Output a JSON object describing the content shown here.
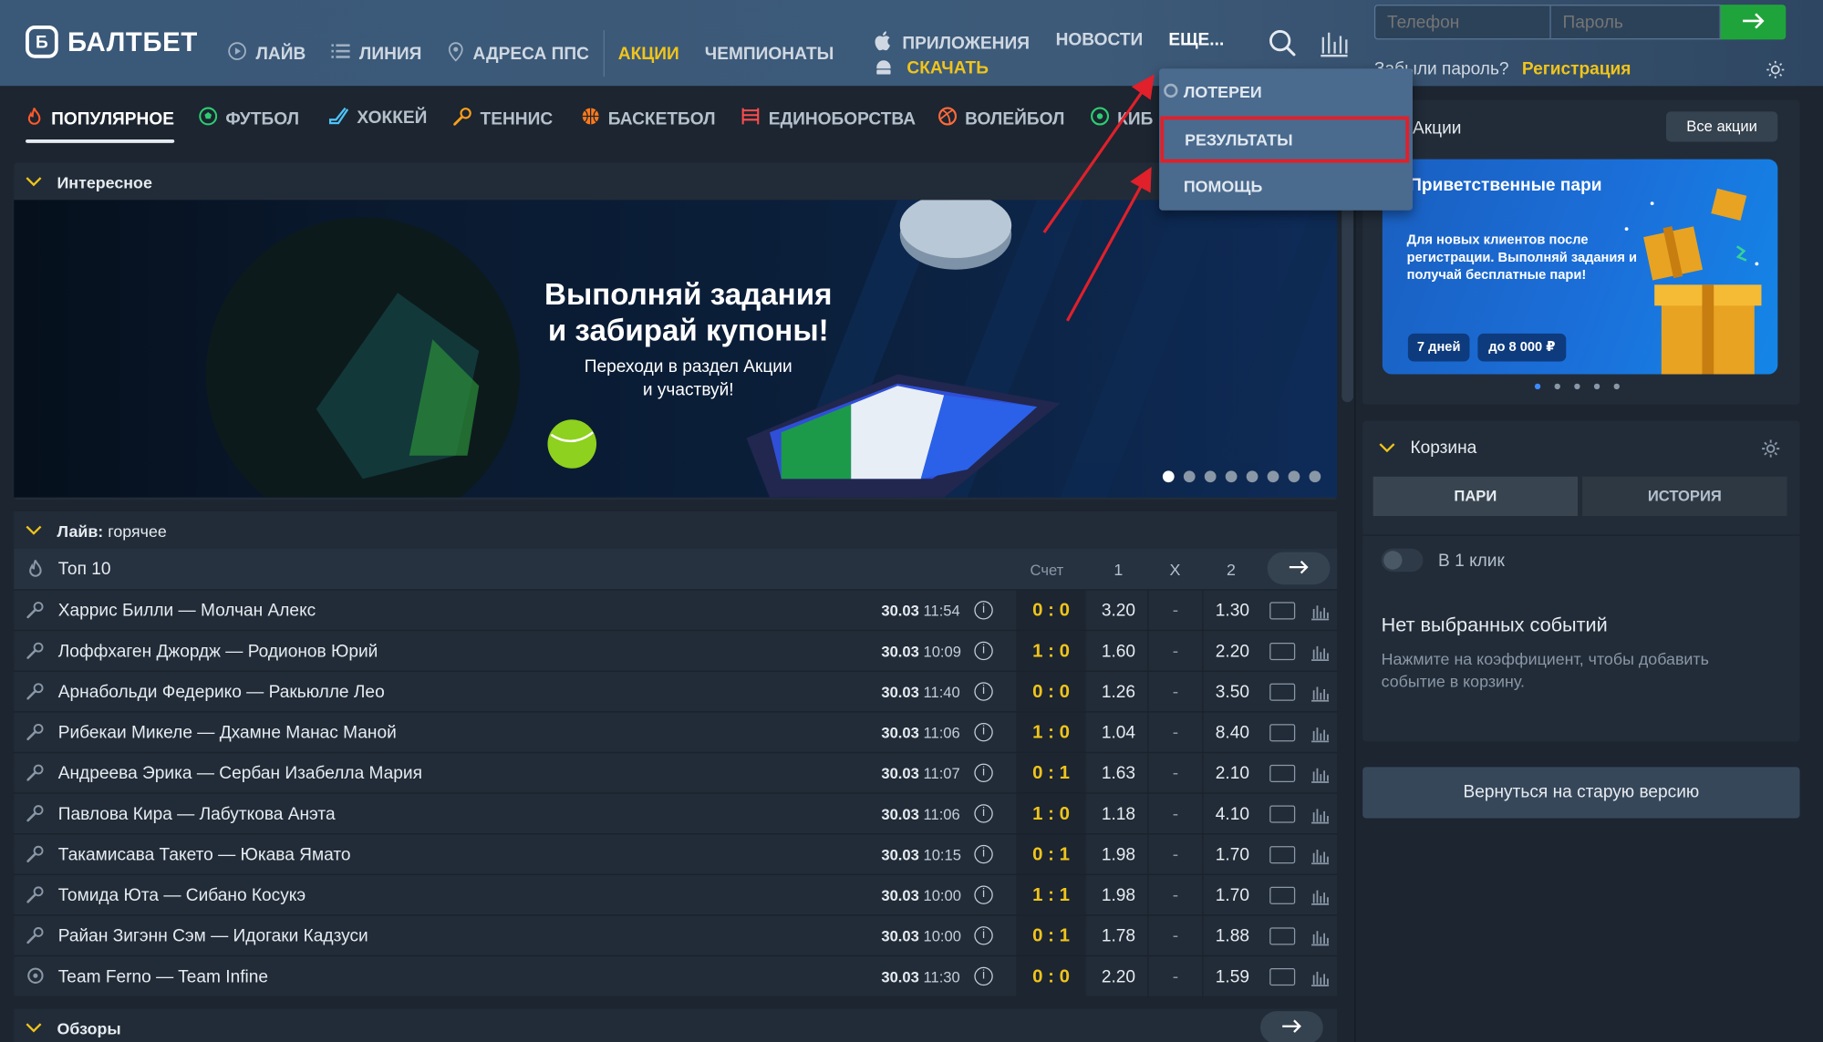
{
  "header": {
    "logo_text": "БАЛТБЕТ",
    "nav": [
      {
        "label": "ЛАЙВ",
        "icon": "play-icon"
      },
      {
        "label": "ЛИНИЯ",
        "icon": "list-icon"
      },
      {
        "label": "АДРЕСА ППС",
        "icon": "location-icon"
      }
    ],
    "promo_link": "АКЦИИ",
    "championships": "ЧЕМПИОНАТЫ",
    "apps": "ПРИЛОЖЕНИЯ",
    "apps_download": "СКАЧАТЬ",
    "news": "НОВОСТИ",
    "more": "ЕЩЕ...",
    "phone_placeholder": "Телефон",
    "password_placeholder": "Пароль",
    "forgot": "Забыли пароль?",
    "register": "Регистрация"
  },
  "dropdown": {
    "items": [
      "ЛОТЕРЕИ",
      "РЕЗУЛЬТАТЫ",
      "ПОМОЩЬ"
    ],
    "highlighted": "РЕЗУЛЬТАТЫ"
  },
  "sport_tabs": [
    {
      "label": "ПОПУЛЯРНОЕ",
      "icon": "fire-icon",
      "color": "#ff5a2a"
    },
    {
      "label": "ФУТБОЛ",
      "icon": "football-icon",
      "color": "#2ecc71"
    },
    {
      "label": "ХОККЕЙ",
      "icon": "hockey-icon",
      "color": "#4fc3f7"
    },
    {
      "label": "ТЕННИС",
      "icon": "tennis-icon",
      "color": "#ff9f1a"
    },
    {
      "label": "БАСКЕТБОЛ",
      "icon": "basketball-icon",
      "color": "#ff7a1a"
    },
    {
      "label": "ЕДИНОБОРСТВА",
      "icon": "fight-icon",
      "color": "#ff4d4d"
    },
    {
      "label": "ВОЛЕЙБОЛ",
      "icon": "volleyball-icon",
      "color": "#ff6a3a"
    },
    {
      "label": "КИБ",
      "icon": "cyber-icon",
      "color": "#2ecc71"
    }
  ],
  "interesting": {
    "title": "Интересное",
    "banner_title_1": "Выполняй задания",
    "banner_title_2": "и забирай купоны!",
    "banner_sub_1": "Переходи в раздел Акции",
    "banner_sub_2": "и участвуй!",
    "slides": 8,
    "active_slide": 1
  },
  "live": {
    "title_bold": "Лайв:",
    "title_rest": "горячее",
    "top10": "Топ 10",
    "col_score": "Счет",
    "col_1": "1",
    "col_x": "X",
    "col_2": "2",
    "rows": [
      {
        "name": "Харрис Билли — Молчан Алекс",
        "date": "30.03",
        "time": "11:54",
        "score": "0 : 0",
        "odd1": "3.20",
        "oddx": "-",
        "odd2": "1.30"
      },
      {
        "name": "Лоффхаген Джордж — Родионов Юрий",
        "date": "30.03",
        "time": "10:09",
        "score": "1 : 0",
        "odd1": "1.60",
        "oddx": "-",
        "odd2": "2.20"
      },
      {
        "name": "Арнабольди Федерико — Ракьюлле Лео",
        "date": "30.03",
        "time": "11:40",
        "score": "0 : 0",
        "odd1": "1.26",
        "oddx": "-",
        "odd2": "3.50"
      },
      {
        "name": "Рибекаи Микеле — Дхамне Манас Маной",
        "date": "30.03",
        "time": "11:06",
        "score": "1 : 0",
        "odd1": "1.04",
        "oddx": "-",
        "odd2": "8.40"
      },
      {
        "name": "Андреева Эрика — Сербан Изабелла Мария",
        "date": "30.03",
        "time": "11:07",
        "score": "0 : 1",
        "odd1": "1.63",
        "oddx": "-",
        "odd2": "2.10"
      },
      {
        "name": "Павлова Кира — Лабуткова Анэта",
        "date": "30.03",
        "time": "11:06",
        "score": "1 : 0",
        "odd1": "1.18",
        "oddx": "-",
        "odd2": "4.10"
      },
      {
        "name": "Такамисава Такето — Юкава Ямато",
        "date": "30.03",
        "time": "10:15",
        "score": "0 : 1",
        "odd1": "1.98",
        "oddx": "-",
        "odd2": "1.70"
      },
      {
        "name": "Томида Юта — Сибано Косукэ",
        "date": "30.03",
        "time": "10:00",
        "score": "1 : 1",
        "odd1": "1.98",
        "oddx": "-",
        "odd2": "1.70"
      },
      {
        "name": "Райан Зигэнн Сэм — Идогаки Кадзуси",
        "date": "30.03",
        "time": "10:00",
        "score": "0 : 1",
        "odd1": "1.78",
        "oddx": "-",
        "odd2": "1.88"
      },
      {
        "name": "Team Ferno — Team Infine",
        "date": "30.03",
        "time": "11:30",
        "score": "0 : 0",
        "odd1": "2.20",
        "oddx": "-",
        "odd2": "1.59"
      }
    ]
  },
  "reviews": {
    "title": "Обзоры"
  },
  "promo": {
    "title": "Акции",
    "all": "Все акции",
    "card_title": "Приветственные пари",
    "card_text": "Для новых клиентов после регистрации. Выполняй задания и получай бесплатные пари!",
    "pill_1": "7 дней",
    "pill_2": "до 8 000 ₽",
    "slides": 5
  },
  "basket": {
    "title": "Корзина",
    "tab_1": "ПАРИ",
    "tab_2": "ИСТОРИЯ",
    "one_click": "В 1 клик",
    "empty_title": "Нет выбранных событий",
    "empty_text": "Нажмите на коэффициент, чтобы добавить событие в корзину."
  },
  "old_version": "Вернуться на старую версию",
  "colors": {
    "accent": "#f0c41b",
    "header_bg": "#3a5878",
    "page_bg": "#1c2530",
    "panel_bg": "#222c38",
    "highlight_border": "#e0202a",
    "login_button": "#1fa43b"
  }
}
